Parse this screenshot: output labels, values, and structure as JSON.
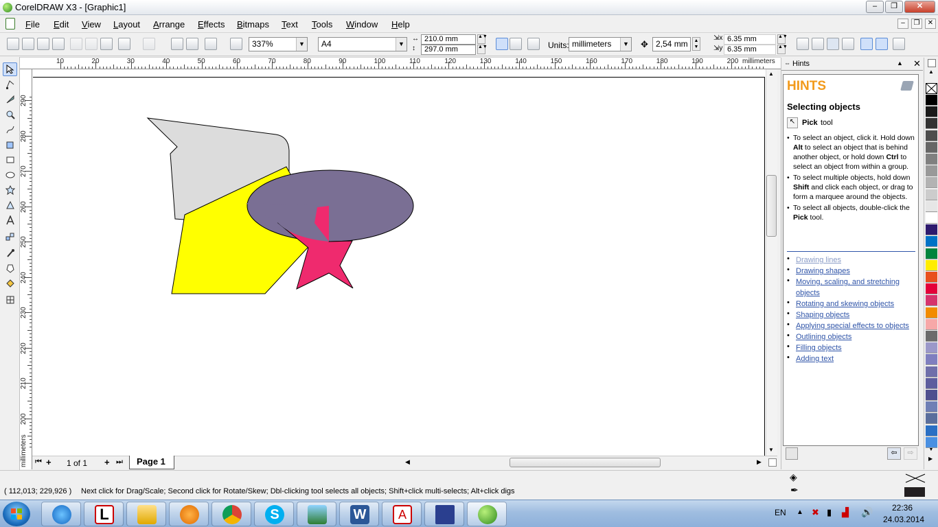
{
  "window": {
    "title": "CorelDRAW X3 - [Graphic1]",
    "minimize": "‒",
    "maximize": "❐",
    "close": "✕"
  },
  "menu": [
    "File",
    "Edit",
    "View",
    "Layout",
    "Arrange",
    "Effects",
    "Bitmaps",
    "Text",
    "Tools",
    "Window",
    "Help"
  ],
  "toolbar": {
    "zoom": "337%",
    "paper_size": "A4",
    "width": "210.0 mm",
    "height": "297.0 mm",
    "units_label": "Units:",
    "units": "millimeters",
    "nudge": "2,54 mm",
    "dup_x": "6.35 mm",
    "dup_y": "6.35 mm"
  },
  "ruler": {
    "h_labels": [
      "10",
      "20",
      "30",
      "40",
      "50",
      "60",
      "70",
      "80",
      "90",
      "100",
      "110",
      "120",
      "130",
      "140",
      "150",
      "160",
      "170",
      "180",
      "190",
      "200"
    ],
    "h_unit": "millimeters",
    "v_labels": [
      "290",
      "280",
      "270",
      "260",
      "250",
      "240",
      "230",
      "220",
      "210",
      "200"
    ],
    "v_unit": "millimeters"
  },
  "pages": {
    "counter": "1 of 1",
    "tab": "Page 1"
  },
  "hints": {
    "docker_title": "Hints",
    "heading": "HINTS",
    "topic": "Selecting objects",
    "tool_name": "Pick",
    "tool_suffix": "tool",
    "bullets": [
      [
        {
          "t": "To select an object, click it. Hold down "
        },
        {
          "t": "Alt",
          "b": true
        },
        {
          "t": " to select an object that is behind another object, or hold down "
        },
        {
          "t": "Ctrl",
          "b": true
        },
        {
          "t": " to select an object from within a group."
        }
      ],
      [
        {
          "t": "To select multiple objects, hold down "
        },
        {
          "t": "Shift",
          "b": true
        },
        {
          "t": " and click each object, or drag to form a marquee around the objects."
        }
      ],
      [
        {
          "t": "To select all objects, double-click the "
        },
        {
          "t": "Pick",
          "b": true
        },
        {
          "t": " tool."
        }
      ]
    ],
    "links": [
      "Drawing lines",
      "Drawing shapes",
      "Moving, scaling, and stretching objects",
      "Rotating and skewing objects",
      "Shaping objects",
      "Applying special effects to objects",
      "Outlining objects",
      "Filling objects",
      "Adding text"
    ]
  },
  "palette": [
    "#ffffff",
    "#000000",
    "#1a1a1a",
    "#333333",
    "#4d4d4d",
    "#666666",
    "#808080",
    "#999999",
    "#b3b3b3",
    "#cccccc",
    "#e6e6e6",
    "#ffffff",
    "#2e1a6e",
    "#0072c6",
    "#00843d",
    "#ffed00",
    "#e8501e",
    "#e4003a",
    "#d6336c",
    "#f28c00",
    "#f7a8a8",
    "#6b6b6b",
    "#9b98c9",
    "#7f7fbf",
    "#6f6faa",
    "#5e5e9e",
    "#4f4f8f",
    "#6f7fb5",
    "#5a6e9c",
    "#2a6fc4",
    "#4a90e2"
  ],
  "status": {
    "coords": "( 112,013; 229,926 )",
    "message": "Next click for Drag/Scale; Second click for Rotate/Skew; Dbl-clicking tool selects all objects; Shift+click multi-selects; Alt+click digs"
  },
  "taskbar": {
    "apps": [
      "Internet Explorer",
      "Lingvo",
      "Windows Explorer",
      "Media Player",
      "Google Chrome",
      "Skype",
      "Photo Viewer",
      "Microsoft Word",
      "Adobe Reader",
      "Save",
      "CorelDRAW"
    ],
    "lang": "EN",
    "time": "22:36",
    "date": "24.03.2014"
  }
}
